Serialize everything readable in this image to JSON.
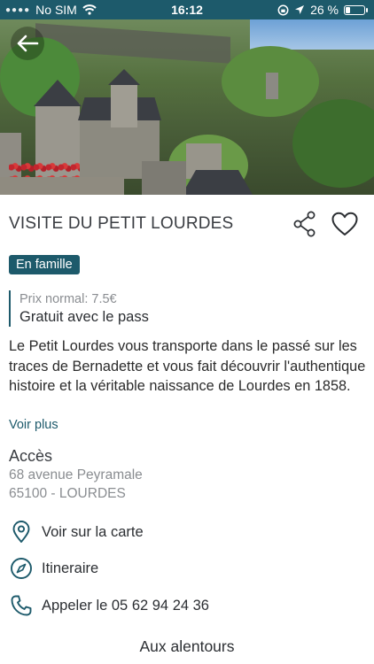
{
  "status_bar": {
    "carrier": "No SIM",
    "time": "16:12",
    "battery": "26 %",
    "battery_level": 0.26
  },
  "hero": {
    "image": "miniature-village-photo"
  },
  "header": {
    "back_icon": "arrow-left-icon",
    "title": "VISITE DU PETIT LOURDES",
    "share_icon": "share-icon",
    "favorite_icon": "heart-icon"
  },
  "badge": "En famille",
  "price": {
    "normal": "Prix normal: 7.5€",
    "pass": "Gratuit avec le pass"
  },
  "description": "Le Petit Lourdes vous transporte dans le passé sur les traces de Bernadette et vous fait découvrir l'authentique histoire et la véritable naissance de Lourdes en 1858.",
  "see_more": "Voir plus",
  "access": {
    "title": "Accès",
    "address_line1": "68 avenue Peyramale",
    "address_line2": "65100 - LOURDES"
  },
  "actions": [
    {
      "icon": "map-pin-icon",
      "label": "Voir sur la carte"
    },
    {
      "icon": "compass-icon",
      "label": "Itineraire"
    },
    {
      "icon": "phone-icon",
      "label": "Appeler le 05 62 94 24 36"
    }
  ],
  "nearby": "Aux alentours",
  "colors": {
    "primary": "#1d5a6b",
    "text": "#2c2f33",
    "muted": "#8a8d91"
  }
}
